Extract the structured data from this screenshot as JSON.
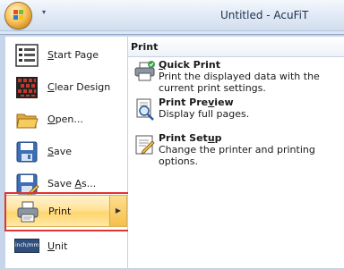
{
  "window": {
    "title": "Untitled - AcuFiT",
    "qat_arrow": "▾"
  },
  "menu": {
    "items": [
      {
        "label_pre": "",
        "label_key": "S",
        "label_post": "tart Page",
        "icon": "start-page-icon"
      },
      {
        "label_pre": "",
        "label_key": "C",
        "label_post": "lear Design",
        "icon": "clear-design-icon"
      },
      {
        "label_pre": "",
        "label_key": "O",
        "label_post": "pen...",
        "icon": "open-folder-icon"
      },
      {
        "label_pre": "",
        "label_key": "S",
        "label_post": "ave",
        "icon": "save-icon"
      },
      {
        "label_pre": "Save ",
        "label_key": "A",
        "label_post": "s...",
        "icon": "save-as-icon"
      },
      {
        "label_pre": "Print",
        "label_key": "",
        "label_post": "",
        "icon": "printer-icon",
        "active": true,
        "arrow": "▶"
      },
      {
        "label_pre": "",
        "label_key": "U",
        "label_post": "nit",
        "icon": "unit-icon",
        "icon_text": "inch/mm"
      }
    ]
  },
  "print_panel": {
    "header": "Print",
    "items": [
      {
        "title_pre": "",
        "title_key": "Q",
        "title_post": "uick Print",
        "desc": "Print the displayed data with the current print settings.",
        "icon": "quick-print-icon"
      },
      {
        "title_pre": "Print Pre",
        "title_key": "v",
        "title_post": "iew",
        "desc": "Display full pages.",
        "icon": "print-preview-icon"
      },
      {
        "title_pre": "Print Set",
        "title_key": "u",
        "title_post": "p",
        "desc": "Change the printer and printing options.",
        "icon": "print-setup-icon"
      }
    ]
  },
  "colors": {
    "highlight": "#e03333",
    "active_bg": "#ffe39b"
  }
}
